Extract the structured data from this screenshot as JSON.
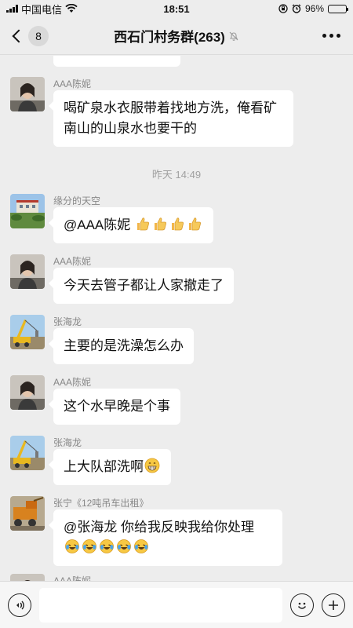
{
  "status_bar": {
    "carrier": "中国电信",
    "time": "18:51",
    "battery": "96%",
    "battery_level": 0.96
  },
  "nav": {
    "unread_count": "8",
    "title": "西石门村务群(263)"
  },
  "chat": {
    "messages": [
      {
        "sender": "AAA陈妮",
        "text": "喝矿泉水衣服带着找地方洗，俺看矿南山的山泉水也要干的"
      },
      {
        "sender": "缘分的天空",
        "text": "@AAA陈妮"
      },
      {
        "sender": "AAA陈妮",
        "text": "今天去管子都让人家撤走了"
      },
      {
        "sender": "张海龙",
        "text": "主要的是洗澡怎么办"
      },
      {
        "sender": "AAA陈妮",
        "text": "这个水早晚是个事"
      },
      {
        "sender": "张海龙",
        "text": "上大队部洗啊"
      },
      {
        "sender": "张宁《12吨吊车出租》",
        "text": "@张海龙 你给我反映我给你处理"
      },
      {
        "sender": "AAA陈妮"
      }
    ],
    "time_separator": "昨天 14:49"
  },
  "icons": {
    "thumbs_up": "thumbs-up-emoji",
    "grin": "grinning-emoji",
    "laugh_cry": "laugh-cry-emoji",
    "voice": "voice-icon",
    "emoji_button": "smiley-icon",
    "plus": "plus-icon",
    "mute": "bell-off-icon"
  },
  "colors": {
    "background": "#ededed",
    "bubble": "#ffffff",
    "meta_text": "#888888"
  }
}
